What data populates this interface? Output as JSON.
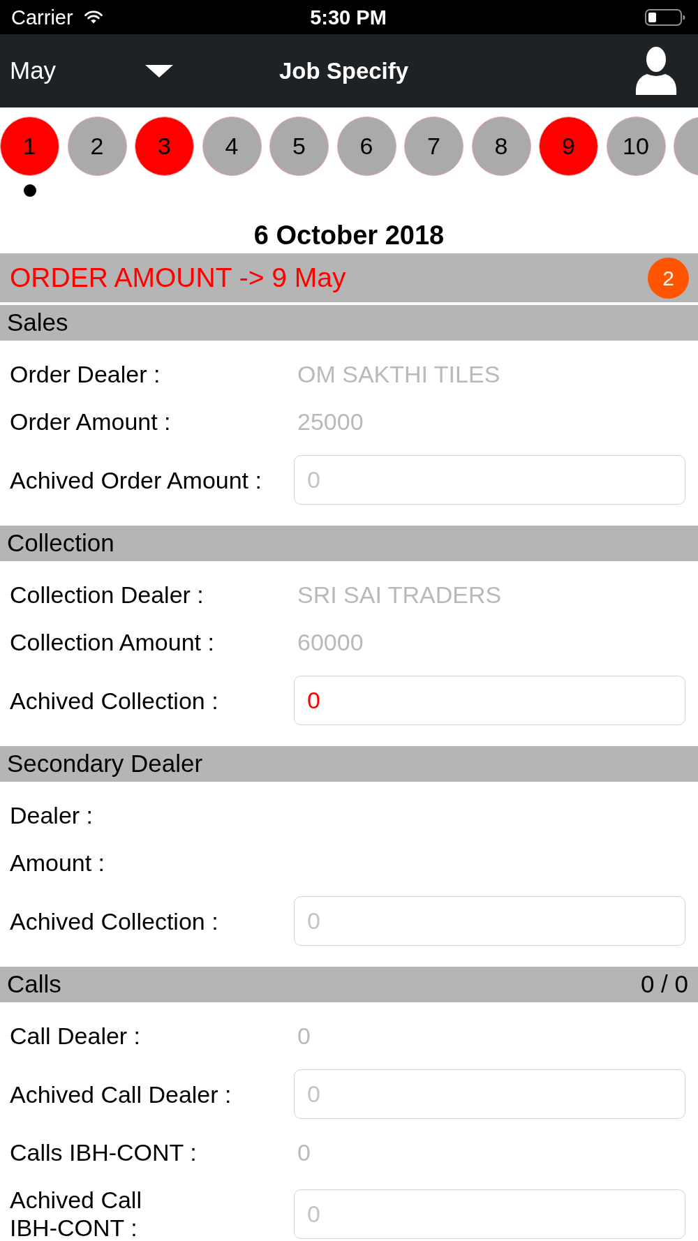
{
  "status_bar": {
    "carrier": "Carrier",
    "time": "5:30 PM"
  },
  "nav_bar": {
    "month": "May",
    "title": "Job Specify"
  },
  "days": [
    {
      "label": "1",
      "flagged": true,
      "selected": true
    },
    {
      "label": "2",
      "flagged": false,
      "selected": false
    },
    {
      "label": "3",
      "flagged": true,
      "selected": false
    },
    {
      "label": "4",
      "flagged": false,
      "selected": false
    },
    {
      "label": "5",
      "flagged": false,
      "selected": false
    },
    {
      "label": "6",
      "flagged": false,
      "selected": false
    },
    {
      "label": "7",
      "flagged": false,
      "selected": false
    },
    {
      "label": "8",
      "flagged": false,
      "selected": false
    },
    {
      "label": "9",
      "flagged": true,
      "selected": false
    },
    {
      "label": "10",
      "flagged": false,
      "selected": false
    }
  ],
  "date": "6 October 2018",
  "order_banner": {
    "text": "ORDER AMOUNT -> 9 May",
    "badge": "2"
  },
  "sections": [
    {
      "title": "Sales",
      "rows": [
        {
          "kind": "text",
          "label": "Order Dealer :",
          "value": "OM SAKTHI TILES"
        },
        {
          "kind": "text",
          "label": "Order Amount :",
          "value": "25000"
        },
        {
          "kind": "input",
          "label": "Achived Order Amount :",
          "placeholder": "0"
        }
      ]
    },
    {
      "title": "Collection",
      "rows": [
        {
          "kind": "text",
          "label": "Collection Dealer :",
          "value": "SRI SAI TRADERS"
        },
        {
          "kind": "text",
          "label": "Collection Amount :",
          "value": "60000"
        },
        {
          "kind": "input",
          "label": "Achived Collection :",
          "value": "0",
          "alert": true
        }
      ]
    },
    {
      "title": "Secondary Dealer",
      "rows": [
        {
          "kind": "text",
          "label": "Dealer :"
        },
        {
          "kind": "text",
          "label": "Amount :"
        },
        {
          "kind": "input",
          "label": "Achived Collection :",
          "placeholder": "0"
        }
      ]
    },
    {
      "title": "Calls",
      "count": "0 / 0",
      "rows": [
        {
          "kind": "text",
          "label": "Call Dealer :",
          "value": "0"
        },
        {
          "kind": "input",
          "label": "Achived Call Dealer :",
          "placeholder": "0"
        },
        {
          "kind": "text",
          "label": "Calls IBH-CONT :",
          "value": "0"
        },
        {
          "kind": "input",
          "label": "Achived Call IBH-CONT :",
          "placeholder": "0"
        }
      ]
    }
  ]
}
